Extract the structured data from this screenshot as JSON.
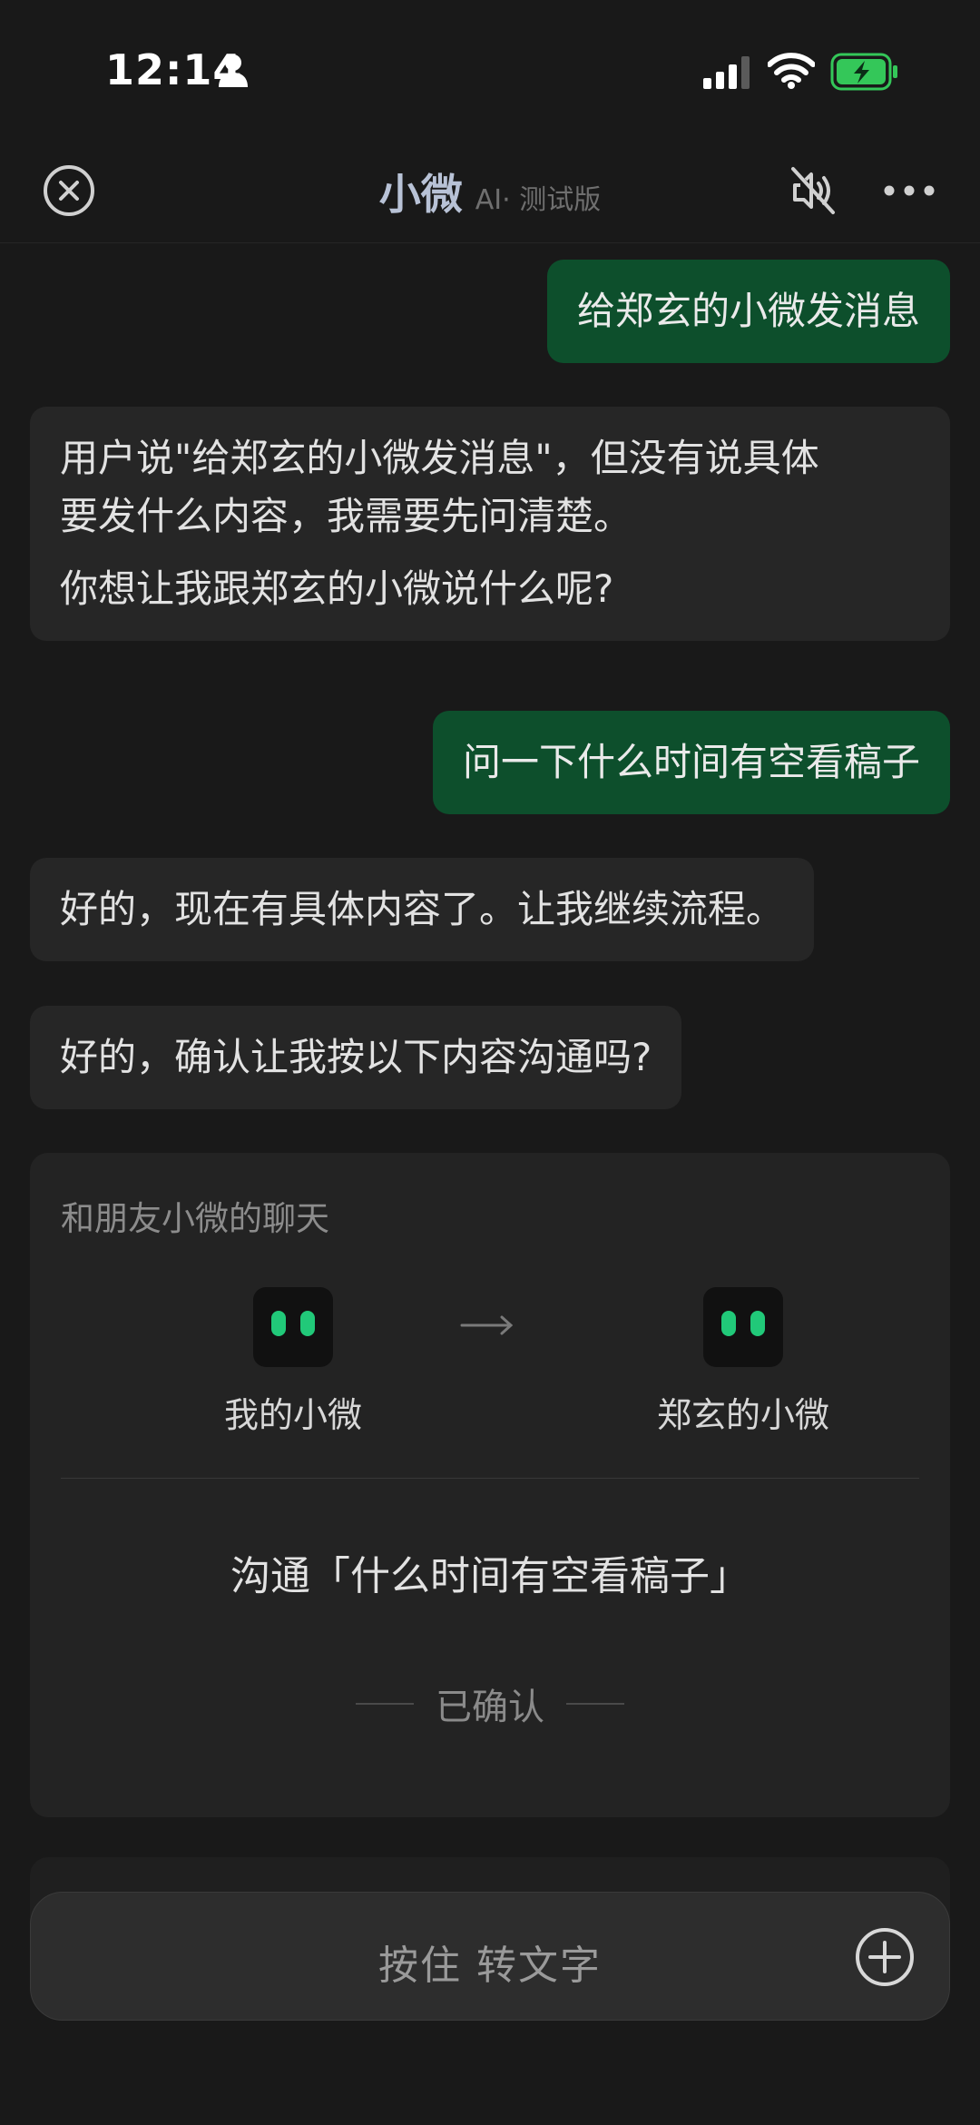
{
  "status_bar": {
    "time": "12:14",
    "icons": [
      "person-icon",
      "signal-icon",
      "wifi-icon",
      "battery-charging-icon"
    ],
    "battery_color": "#34c759"
  },
  "header": {
    "title": "小微",
    "subtitle": "AI· 测试版",
    "icons": [
      "close-icon",
      "mute-icon",
      "more-icon"
    ]
  },
  "messages": [
    {
      "role": "user",
      "text": "给郑玄的小微发消息"
    },
    {
      "role": "bot",
      "paragraphs": [
        "用户说\"给郑玄的小微发消息\"，但没有说具体",
        "要发什么内容，我需要先问清楚。",
        "你想让我跟郑玄的小微说什么呢?"
      ]
    },
    {
      "role": "user",
      "text": "问一下什么时间有空看稿子"
    },
    {
      "role": "bot",
      "text": "好的，现在有具体内容了。让我继续流程。"
    },
    {
      "role": "bot",
      "text": "好的，确认让我按以下内容沟通吗?"
    }
  ],
  "card": {
    "header": "和朋友小微的聊天",
    "from_name": "我的小微",
    "to_name": "郑玄的小微",
    "topic": "沟通「什么时间有空看稿子」",
    "status": "已确认",
    "accent": "#21c979"
  },
  "input": {
    "label": "按住 转文字",
    "icon": "plus-circle-icon"
  },
  "colors": {
    "background": "#191919",
    "user_bubble": "#0d4f2c",
    "bot_bubble": "#262626"
  }
}
